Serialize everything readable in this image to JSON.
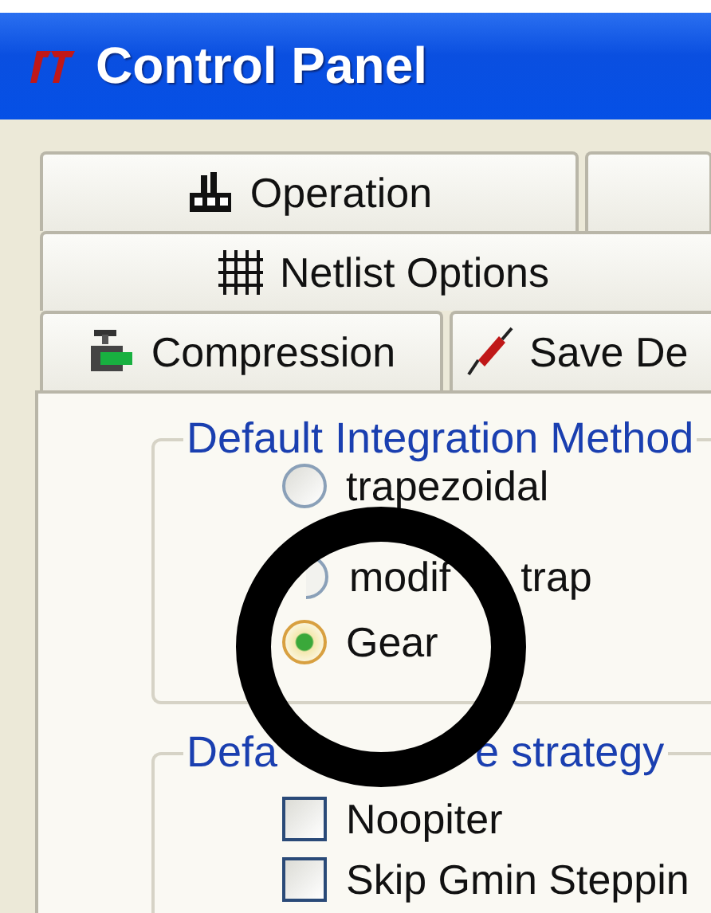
{
  "window": {
    "title": "Control Panel"
  },
  "tab_rows": [
    [
      {
        "label": "Operation",
        "selected": false
      },
      {
        "selected": false
      }
    ],
    [
      {
        "label": "Netlist Options",
        "selected": false
      }
    ],
    [
      {
        "label": "Compression",
        "selected": false
      },
      {
        "label": "Save De",
        "selected": false
      }
    ]
  ],
  "groups": [
    {
      "title_parts": [
        "Default Integration Method"
      ],
      "kind": "radio",
      "options": [
        {
          "label_parts": [
            "trapezoidal"
          ],
          "selected": false
        },
        {
          "label_parts": [
            "modif",
            "trap"
          ],
          "selected": false
        },
        {
          "label_parts": [
            "Gear"
          ],
          "selected": true
        }
      ]
    },
    {
      "title_parts": [
        "Defa",
        "e strategy"
      ],
      "kind": "checkbox",
      "options": [
        {
          "label_parts": [
            "Noopiter"
          ],
          "checked": false
        },
        {
          "label_parts": [
            "Skip Gmin Steppin"
          ],
          "checked": false
        }
      ]
    }
  ]
}
